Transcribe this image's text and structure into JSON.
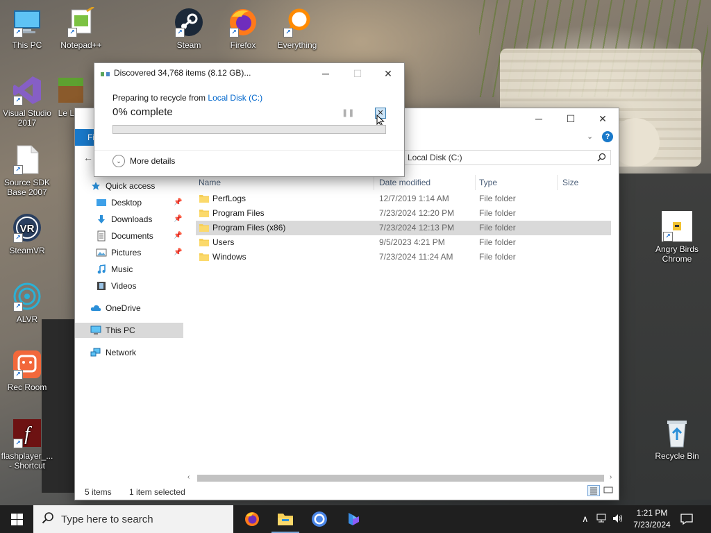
{
  "desktop": {
    "icons": [
      {
        "label": "This PC"
      },
      {
        "label": "Notepad++"
      },
      {
        "label": "Steam"
      },
      {
        "label": "Firefox"
      },
      {
        "label": "Everything"
      },
      {
        "label": "Visual Studio 2017"
      },
      {
        "label": "Le Lau"
      },
      {
        "label": "Source SDK Base 2007"
      },
      {
        "label": "SteamVR"
      },
      {
        "label": "ALVR"
      },
      {
        "label": "Rec Room"
      },
      {
        "label": "flashplayer_... - Shortcut"
      },
      {
        "label": "Angry Birds Chrome"
      },
      {
        "label": "Recycle Bin"
      }
    ]
  },
  "explorer": {
    "ribbon_tab": "Fi",
    "address": "Local Disk (C:)",
    "sidebar": [
      {
        "label": "Quick access"
      },
      {
        "label": "Desktop"
      },
      {
        "label": "Downloads"
      },
      {
        "label": "Documents"
      },
      {
        "label": "Pictures"
      },
      {
        "label": "Music"
      },
      {
        "label": "Videos"
      },
      {
        "label": "OneDrive"
      },
      {
        "label": "This PC"
      },
      {
        "label": "Network"
      }
    ],
    "columns": [
      "Name",
      "Date modified",
      "Type",
      "Size"
    ],
    "rows": [
      {
        "name": "PerfLogs",
        "date": "12/7/2019 1:14 AM",
        "type": "File folder",
        "size": ""
      },
      {
        "name": "Program Files",
        "date": "7/23/2024 12:20 PM",
        "type": "File folder",
        "size": ""
      },
      {
        "name": "Program Files (x86)",
        "date": "7/23/2024 12:13 PM",
        "type": "File folder",
        "size": ""
      },
      {
        "name": "Users",
        "date": "9/5/2023 4:21 PM",
        "type": "File folder",
        "size": ""
      },
      {
        "name": "Windows",
        "date": "7/23/2024 11:24 AM",
        "type": "File folder",
        "size": ""
      }
    ],
    "status": {
      "items": "5 items",
      "selected": "1 item selected"
    }
  },
  "dialog": {
    "title": "Discovered 34,768 items (8.12 GB)...",
    "preparing_prefix": "Preparing to recycle from ",
    "source_link": "Local Disk (C:)",
    "percent_text": "0% complete",
    "progress": 0,
    "more_details": "More details"
  },
  "taskbar": {
    "search_placeholder": "Type here to search",
    "time": "1:21 PM",
    "date": "7/23/2024"
  },
  "colors": {
    "accent": "#1979ca",
    "link": "#0066cc",
    "progress": "#06b025",
    "taskbar": "#1f1f1f"
  }
}
